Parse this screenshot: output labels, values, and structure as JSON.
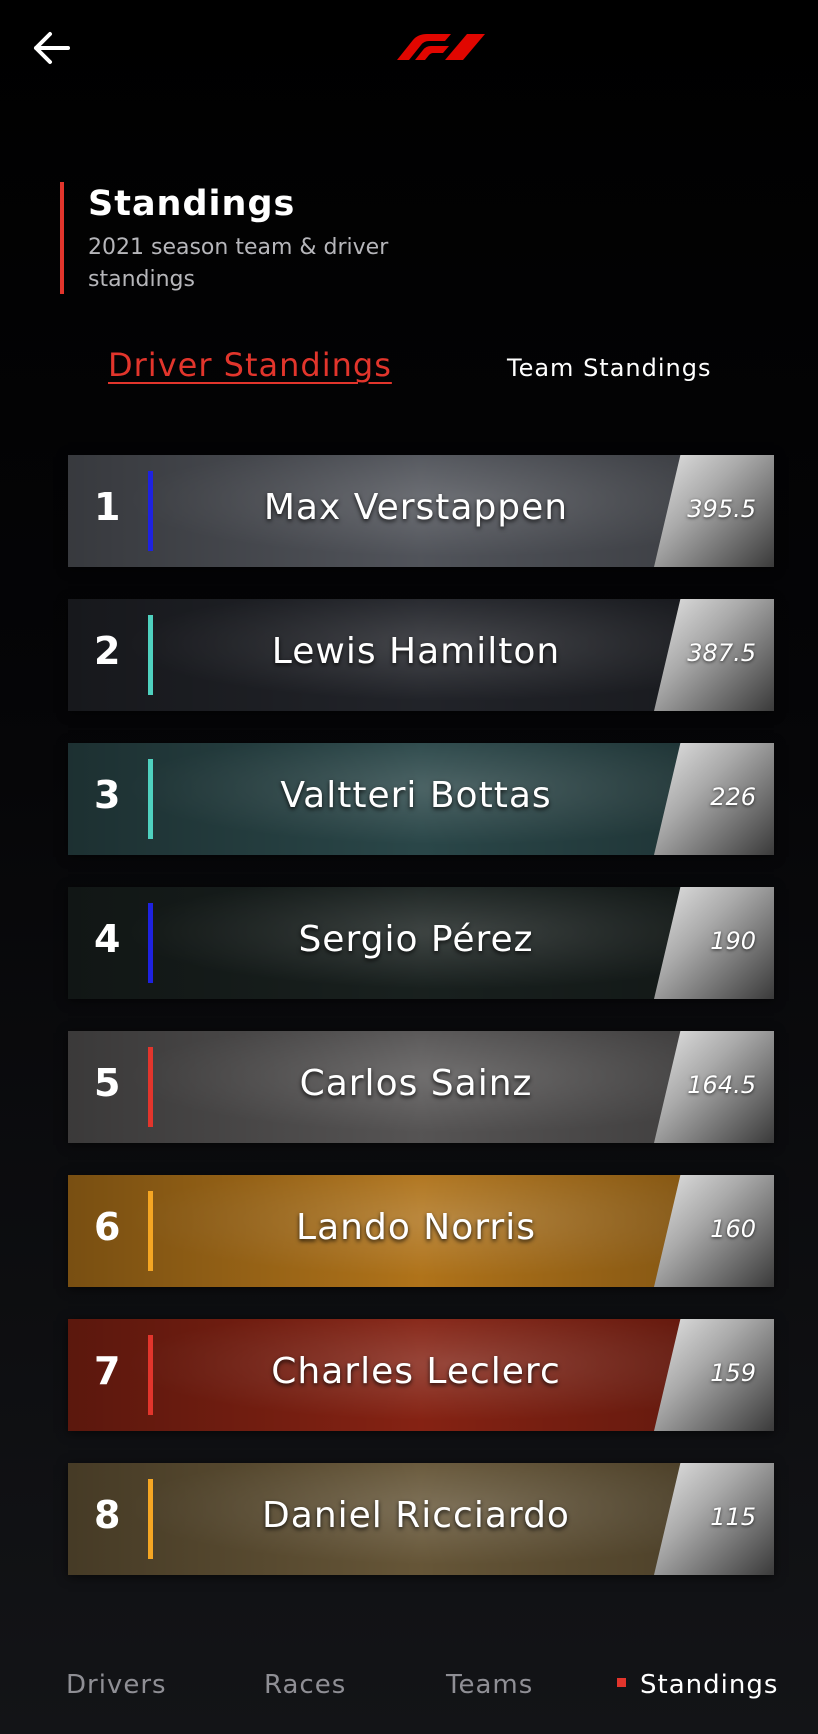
{
  "topbar": {
    "back_icon": "arrow-left-icon",
    "logo": "F1"
  },
  "header": {
    "title": "Standings",
    "subtitle": "2021 season team & driver standings",
    "accent_color": "#e2352c"
  },
  "tabs": [
    {
      "label": "Driver Standings",
      "active": true
    },
    {
      "label": "Team Standings",
      "active": false
    }
  ],
  "drivers": [
    {
      "pos": "1",
      "name": "Max Verstappen",
      "points": "395.5",
      "team_color": "#1e22e0",
      "bg": "#55585f"
    },
    {
      "pos": "2",
      "name": "Lewis Hamilton",
      "points": "387.5",
      "team_color": "#4fd1bf",
      "bg": "#23252b"
    },
    {
      "pos": "3",
      "name": "Valtteri Bottas",
      "points": "226",
      "team_color": "#4fd1bf",
      "bg": "#2c4a4c"
    },
    {
      "pos": "4",
      "name": "Sergio Pérez",
      "points": "190",
      "team_color": "#1e22e0",
      "bg": "#1a2220"
    },
    {
      "pos": "5",
      "name": "Carlos Sainz",
      "points": "164.5",
      "team_color": "#e2352c",
      "bg": "#5a5858"
    },
    {
      "pos": "6",
      "name": "Lando Norris",
      "points": "160",
      "team_color": "#f5a623",
      "bg": "#b9791b"
    },
    {
      "pos": "7",
      "name": "Charles Leclerc",
      "points": "159",
      "team_color": "#e2352c",
      "bg": "#8c2414"
    },
    {
      "pos": "8",
      "name": "Daniel Ricciardo",
      "points": "115",
      "team_color": "#f5a623",
      "bg": "#6b5a3a"
    }
  ],
  "nav": [
    {
      "label": "Drivers",
      "active": false
    },
    {
      "label": "Races",
      "active": false
    },
    {
      "label": "Teams",
      "active": false
    },
    {
      "label": "Standings",
      "active": true
    }
  ]
}
